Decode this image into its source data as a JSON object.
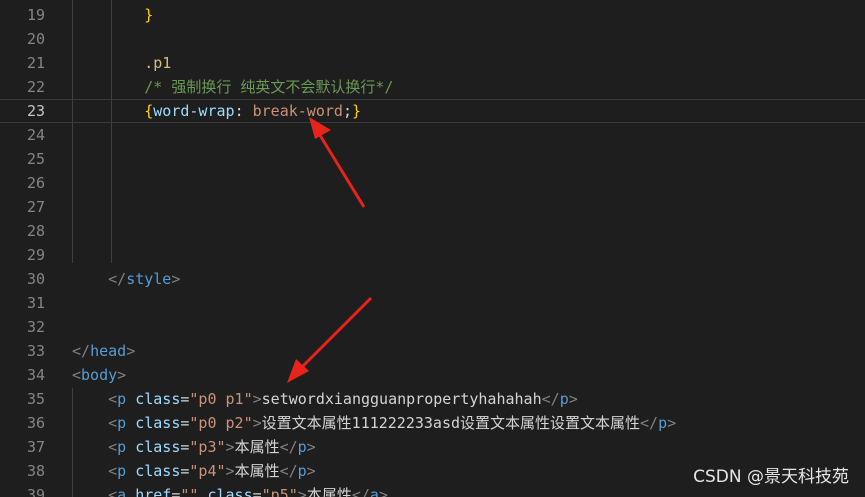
{
  "editor": {
    "lines": [
      {
        "num": "19",
        "tokens": [
          {
            "t": "}",
            "c": "tok-brace"
          }
        ]
      },
      {
        "num": "20",
        "tokens": []
      },
      {
        "num": "21",
        "tokens": [
          {
            "t": ".p1",
            "c": "tok-sel"
          }
        ]
      },
      {
        "num": "22",
        "tokens": [
          {
            "t": "/* 强制换行 纯英文不会默认换行*/",
            "c": "tok-comment"
          }
        ]
      },
      {
        "num": "23",
        "tokens": [
          {
            "t": "{",
            "c": "tok-brace"
          },
          {
            "t": "word-wrap",
            "c": "tok-prop"
          },
          {
            "t": ": ",
            "c": "tok-punc"
          },
          {
            "t": "break-word",
            "c": "tok-val"
          },
          {
            "t": ";",
            "c": "tok-punc"
          },
          {
            "t": "}",
            "c": "tok-brace"
          }
        ]
      },
      {
        "num": "24",
        "tokens": []
      },
      {
        "num": "25",
        "tokens": []
      },
      {
        "num": "26",
        "tokens": []
      },
      {
        "num": "27",
        "tokens": []
      },
      {
        "num": "28",
        "tokens": []
      },
      {
        "num": "29",
        "tokens": []
      },
      {
        "num": "30",
        "tokens": [
          {
            "t": "</",
            "c": "tok-tagbr"
          },
          {
            "t": "style",
            "c": "tok-tag"
          },
          {
            "t": ">",
            "c": "tok-tagbr"
          }
        ]
      },
      {
        "num": "31",
        "tokens": []
      },
      {
        "num": "32",
        "tokens": []
      },
      {
        "num": "33",
        "tokens": [
          {
            "t": "</",
            "c": "tok-tagbr"
          },
          {
            "t": "head",
            "c": "tok-tag"
          },
          {
            "t": ">",
            "c": "tok-tagbr"
          }
        ]
      },
      {
        "num": "34",
        "tokens": [
          {
            "t": "<",
            "c": "tok-tagbr"
          },
          {
            "t": "body",
            "c": "tok-tag"
          },
          {
            "t": ">",
            "c": "tok-tagbr"
          }
        ]
      },
      {
        "num": "35",
        "tokens": [
          {
            "t": "<",
            "c": "tok-tagbr"
          },
          {
            "t": "p",
            "c": "tok-tag"
          },
          {
            "t": " ",
            "c": "tok-text"
          },
          {
            "t": "class",
            "c": "tok-attr"
          },
          {
            "t": "=",
            "c": "tok-text"
          },
          {
            "t": "\"p0 p1\"",
            "c": "tok-str"
          },
          {
            "t": ">",
            "c": "tok-tagbr"
          },
          {
            "t": "setwordxiangguanpropertyhahahah",
            "c": "tok-text"
          },
          {
            "t": "</",
            "c": "tok-tagbr"
          },
          {
            "t": "p",
            "c": "tok-tag"
          },
          {
            "t": ">",
            "c": "tok-tagbr"
          }
        ]
      },
      {
        "num": "36",
        "tokens": [
          {
            "t": "<",
            "c": "tok-tagbr"
          },
          {
            "t": "p",
            "c": "tok-tag"
          },
          {
            "t": " ",
            "c": "tok-text"
          },
          {
            "t": "class",
            "c": "tok-attr"
          },
          {
            "t": "=",
            "c": "tok-text"
          },
          {
            "t": "\"p0 p2\"",
            "c": "tok-str"
          },
          {
            "t": ">",
            "c": "tok-tagbr"
          },
          {
            "t": "设置文本属性111222233asd设置文本属性设置文本属性",
            "c": "tok-text"
          },
          {
            "t": "</",
            "c": "tok-tagbr"
          },
          {
            "t": "p",
            "c": "tok-tag"
          },
          {
            "t": ">",
            "c": "tok-tagbr"
          }
        ]
      },
      {
        "num": "37",
        "tokens": [
          {
            "t": "<",
            "c": "tok-tagbr"
          },
          {
            "t": "p",
            "c": "tok-tag"
          },
          {
            "t": " ",
            "c": "tok-text"
          },
          {
            "t": "class",
            "c": "tok-attr"
          },
          {
            "t": "=",
            "c": "tok-text"
          },
          {
            "t": "\"p3\"",
            "c": "tok-str"
          },
          {
            "t": ">",
            "c": "tok-tagbr"
          },
          {
            "t": "本属性",
            "c": "tok-text"
          },
          {
            "t": "</",
            "c": "tok-tagbr"
          },
          {
            "t": "p",
            "c": "tok-tag"
          },
          {
            "t": ">",
            "c": "tok-tagbr"
          }
        ]
      },
      {
        "num": "38",
        "tokens": [
          {
            "t": "<",
            "c": "tok-tagbr"
          },
          {
            "t": "p",
            "c": "tok-tag"
          },
          {
            "t": " ",
            "c": "tok-text"
          },
          {
            "t": "class",
            "c": "tok-attr"
          },
          {
            "t": "=",
            "c": "tok-text"
          },
          {
            "t": "\"p4\"",
            "c": "tok-str"
          },
          {
            "t": ">",
            "c": "tok-tagbr"
          },
          {
            "t": "本属性",
            "c": "tok-text"
          },
          {
            "t": "</",
            "c": "tok-tagbr"
          },
          {
            "t": "p",
            "c": "tok-tag"
          },
          {
            "t": ">",
            "c": "tok-tagbr"
          }
        ]
      },
      {
        "num": "39",
        "tokens": [
          {
            "t": "<",
            "c": "tok-tagbr"
          },
          {
            "t": "a",
            "c": "tok-tag"
          },
          {
            "t": " ",
            "c": "tok-text"
          },
          {
            "t": "href",
            "c": "tok-attr"
          },
          {
            "t": "=",
            "c": "tok-text"
          },
          {
            "t": "\"\"",
            "c": "tok-str"
          },
          {
            "t": " ",
            "c": "tok-text"
          },
          {
            "t": "class",
            "c": "tok-attr"
          },
          {
            "t": "=",
            "c": "tok-text"
          },
          {
            "t": "\"p5\"",
            "c": "tok-str"
          },
          {
            "t": ">",
            "c": "tok-tagbr"
          },
          {
            "t": "本属性",
            "c": "tok-text"
          },
          {
            "t": "</",
            "c": "tok-tagbr"
          },
          {
            "t": "a",
            "c": "tok-tag"
          },
          {
            "t": ">",
            "c": "tok-tagbr"
          }
        ]
      }
    ],
    "current_line": "23"
  },
  "watermark": "CSDN @景天科技苑",
  "colors": {
    "background": "#1e1e1e",
    "arrow": "#e8231b"
  }
}
